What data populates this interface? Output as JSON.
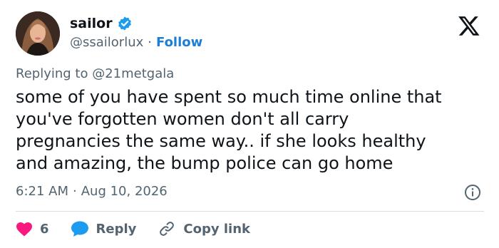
{
  "author": {
    "name": "sailor",
    "handle": "@ssailorlux",
    "separator": "·",
    "follow_label": "Follow",
    "verified_icon": "verified-badge-icon"
  },
  "brand": {
    "logo_icon": "x-logo-icon"
  },
  "reply_context": {
    "prefix": "Replying to",
    "mention": "@21metgala"
  },
  "tweet": {
    "text": "some of you have spent so much time online that\nyou've forgotten women don't all carry\npregnancies the same way.. if she looks healthy\nand amazing, the bump police can go home"
  },
  "meta": {
    "time": "6:21 AM",
    "separator": "·",
    "date": "Aug 10, 2026",
    "info_icon": "info-icon"
  },
  "actions": {
    "like_count": "6",
    "reply_label": "Reply",
    "copy_link_label": "Copy link"
  },
  "colors": {
    "accent": "#1d9bf0",
    "follow_text": "#1d7ed6",
    "like": "#f91880",
    "text": "#0f1419",
    "secondary": "#536471"
  }
}
